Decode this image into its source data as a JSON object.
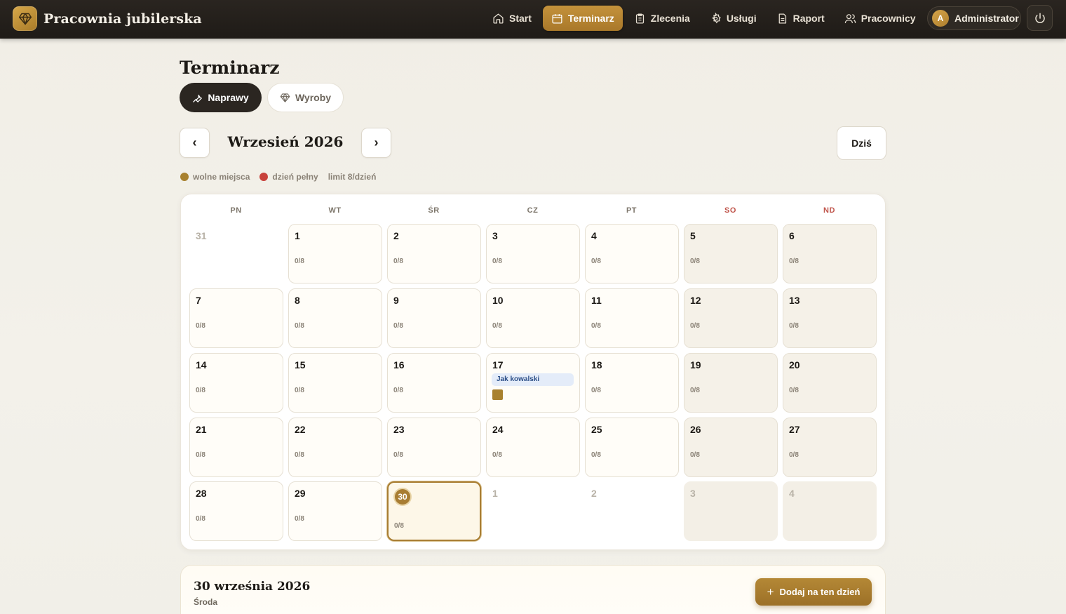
{
  "app": {
    "title": "Pracownia jubilerska",
    "logo_icon": "diamond-icon",
    "accent": "#b08430",
    "dark": "#231f1b"
  },
  "nav": {
    "items": [
      {
        "label": "Start",
        "icon": "home-icon"
      },
      {
        "label": "Terminarz",
        "icon": "calendar-icon",
        "active": true
      },
      {
        "label": "Zlecenia",
        "icon": "clipboard-icon"
      },
      {
        "label": "Usługi",
        "icon": "gear-icon"
      },
      {
        "label": "Raport",
        "icon": "document-icon"
      },
      {
        "label": "Pracownicy",
        "icon": "users-icon"
      }
    ]
  },
  "user": {
    "initial": "A",
    "name": "Administrator",
    "logout_icon": "power-icon"
  },
  "page": {
    "title": "Terminarz"
  },
  "segments": {
    "repairs": "Naprawy",
    "products": "Wyroby"
  },
  "month": {
    "label": "Wrzesień 2026",
    "prev": "‹",
    "next": "›",
    "today": "Dziś"
  },
  "legend": {
    "free": "wolne miejsca",
    "free_color": "#a8812f",
    "full": "dzień pełny",
    "full_color": "#c8423c",
    "limit": "limit 8/dzień"
  },
  "calendar": {
    "weekdays": [
      "PN",
      "WT",
      "ŚR",
      "CZ",
      "PT",
      "SO",
      "ND"
    ],
    "weeks": [
      [
        {
          "d": "31",
          "o": true
        },
        {
          "d": "1",
          "c": "0/8"
        },
        {
          "d": "2",
          "c": "0/8"
        },
        {
          "d": "3",
          "c": "0/8"
        },
        {
          "d": "4",
          "c": "0/8"
        },
        {
          "d": "5",
          "c": "0/8"
        },
        {
          "d": "6",
          "c": "0/8"
        }
      ],
      [
        {
          "d": "7",
          "c": "0/8"
        },
        {
          "d": "8",
          "c": "0/8"
        },
        {
          "d": "9",
          "c": "0/8"
        },
        {
          "d": "10",
          "c": "0/8"
        },
        {
          "d": "11",
          "c": "0/8"
        },
        {
          "d": "12",
          "c": "0/8"
        },
        {
          "d": "13",
          "c": "0/8"
        }
      ],
      [
        {
          "d": "14",
          "c": "0/8"
        },
        {
          "d": "15",
          "c": "0/8"
        },
        {
          "d": "16",
          "c": "0/8"
        },
        {
          "d": "17",
          "event": "Jak kowalski"
        },
        {
          "d": "18",
          "c": "0/8"
        },
        {
          "d": "19",
          "c": "0/8"
        },
        {
          "d": "20",
          "c": "0/8"
        }
      ],
      [
        {
          "d": "21",
          "c": "0/8"
        },
        {
          "d": "22",
          "c": "0/8"
        },
        {
          "d": "23",
          "c": "0/8"
        },
        {
          "d": "24",
          "c": "0/8"
        },
        {
          "d": "25",
          "c": "0/8"
        },
        {
          "d": "26",
          "c": "0/8"
        },
        {
          "d": "27",
          "c": "0/8"
        }
      ],
      [
        {
          "d": "28",
          "c": "0/8"
        },
        {
          "d": "29",
          "c": "0/8"
        },
        {
          "d": "30",
          "c": "0/8",
          "today": true
        },
        {
          "d": "1",
          "o": true
        },
        {
          "d": "2",
          "o": true
        },
        {
          "d": "3",
          "o": true
        },
        {
          "d": "4",
          "o": true
        }
      ]
    ]
  },
  "selected_day": {
    "title": "30 września 2026",
    "weekday": "Środa",
    "add_label": "Dodaj na ten dzień"
  }
}
